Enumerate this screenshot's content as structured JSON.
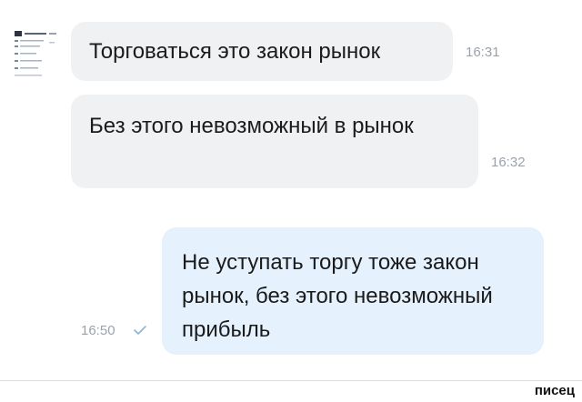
{
  "messages": [
    {
      "text": "Торговаться это закон рынок",
      "time": "16:31"
    },
    {
      "text": "Без этого невозможный в рынок",
      "time": "16:32"
    },
    {
      "text": "Не уступать торгу тоже закон рынок, без этого невозможный прибыль",
      "time": "16:50"
    }
  ],
  "watermark": "писец",
  "colors": {
    "incoming_bubble": "#f0f1f3",
    "outgoing_bubble": "#e5f1fc",
    "time_text": "#9aa3ad",
    "read_check": "#8fb3d9"
  },
  "icons": {
    "sender_avatar": "avatar-thumbnail",
    "read_status": "check-icon"
  }
}
